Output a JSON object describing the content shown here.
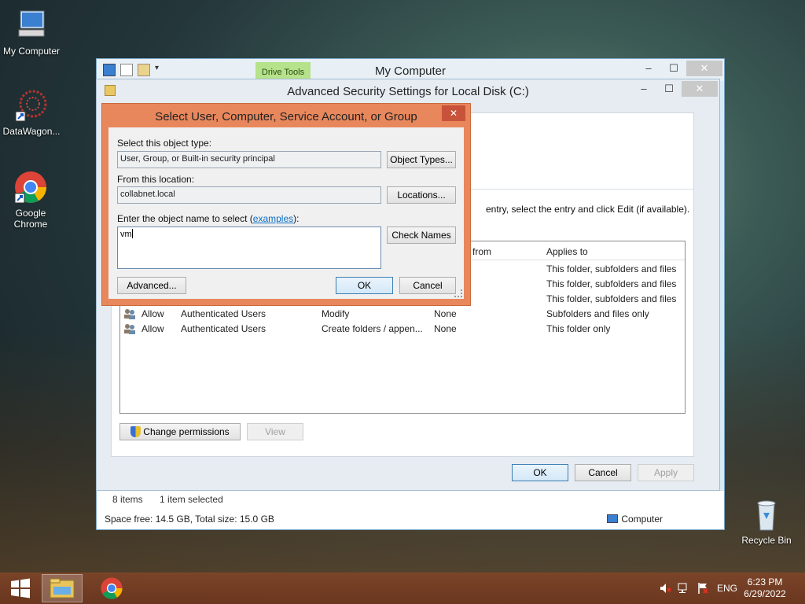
{
  "desktop": {
    "icons": [
      {
        "label": "My Computer"
      },
      {
        "label": "DataWagon..."
      },
      {
        "label": "Google Chrome"
      },
      {
        "label": "Recycle Bin"
      }
    ]
  },
  "explorer": {
    "title": "My Computer",
    "drive_tools": "Drive Tools",
    "status": {
      "items": "8 items",
      "selected": "1 item selected",
      "space": "Space free: 14.5 GB, Total size: 15.0 GB",
      "computer": "Computer"
    }
  },
  "adv": {
    "title": "Advanced Security Settings for Local Disk (C:)",
    "hint": "entry, select the entry and click Edit (if available).",
    "columns": {
      "inherited": "from",
      "applies": "Applies to"
    },
    "rows": [
      {
        "type": "",
        "principal": "",
        "access": "",
        "inherited": "",
        "applies": "This folder, subfolders and files"
      },
      {
        "type": "",
        "principal": "",
        "access": "",
        "inherited": "",
        "applies": "This folder, subfolders and files"
      },
      {
        "type": "",
        "principal": "",
        "access": "",
        "inherited": "",
        "applies": "This folder, subfolders and files"
      },
      {
        "type": "Allow",
        "principal": "Authenticated Users",
        "access": "Modify",
        "inherited": "None",
        "applies": "Subfolders and files only"
      },
      {
        "type": "Allow",
        "principal": "Authenticated Users",
        "access": "Create folders / appen...",
        "inherited": "None",
        "applies": "This folder only"
      }
    ],
    "buttons": {
      "change": "Change permissions",
      "view": "View",
      "ok": "OK",
      "cancel": "Cancel",
      "apply": "Apply"
    }
  },
  "select": {
    "title": "Select User, Computer, Service Account, or Group",
    "object_type_label": "Select this object type:",
    "object_type_value": "User, Group, or Built-in security principal",
    "object_types_btn": "Object Types...",
    "location_label": "From this location:",
    "location_value": "collabnet.local",
    "locations_btn": "Locations...",
    "name_label_prefix": "Enter the object name to select (",
    "name_label_link": "examples",
    "name_label_suffix": "):",
    "name_value": "vm",
    "check_names_btn": "Check Names",
    "advanced_btn": "Advanced...",
    "ok_btn": "OK",
    "cancel_btn": "Cancel"
  },
  "taskbar": {
    "lang": "ENG",
    "time": "6:23 PM",
    "date": "6/29/2022"
  }
}
